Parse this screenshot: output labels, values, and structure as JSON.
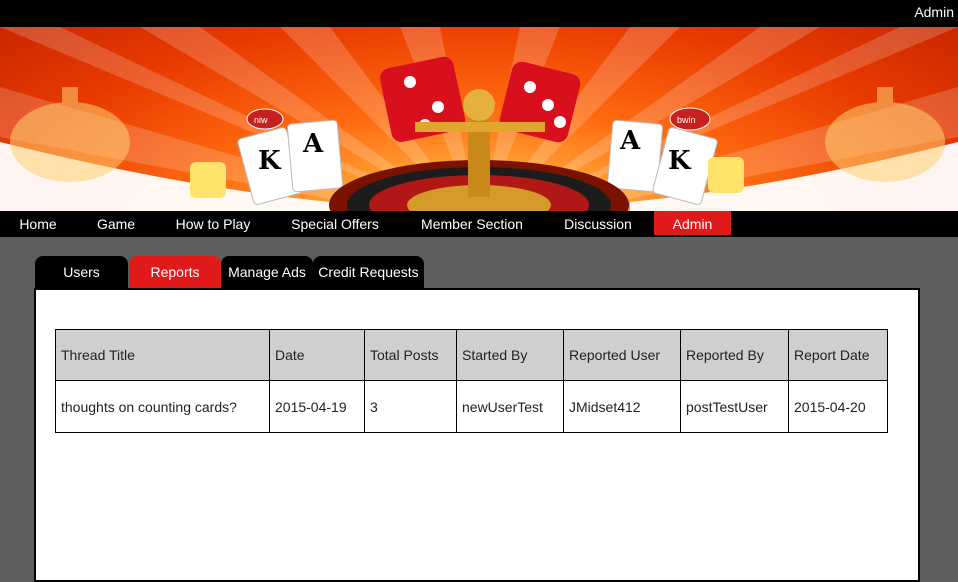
{
  "topbar": {
    "user_label": "Admin"
  },
  "nav": {
    "items": [
      {
        "label": "Home"
      },
      {
        "label": "Game"
      },
      {
        "label": "How to Play"
      },
      {
        "label": "Special Offers"
      },
      {
        "label": "Member Section"
      },
      {
        "label": "Discussion"
      },
      {
        "label": "Admin",
        "active": true
      }
    ]
  },
  "tabs": [
    {
      "label": "Users"
    },
    {
      "label": "Reports",
      "active": true
    },
    {
      "label": "Manage Ads"
    },
    {
      "label": "Credit Requests"
    }
  ],
  "banner": {
    "left_card_ranks": [
      "K",
      "A"
    ],
    "right_card_ranks": [
      "A",
      "K"
    ],
    "chip_text": "bwin"
  },
  "reports_table": {
    "headers": [
      "Thread Title",
      "Date",
      "Total Posts",
      "Started By",
      "Reported User",
      "Reported By",
      "Report Date"
    ],
    "rows": [
      [
        "thoughts on counting cards?",
        "2015-04-19",
        "3",
        "newUserTest",
        "JMidset412",
        "postTestUser",
        "2015-04-20"
      ]
    ]
  },
  "colors": {
    "accent": "#e01a1a",
    "nav_bg": "#000000",
    "page_bg": "#5e5e5e",
    "header_cell_bg": "#cfcfcf"
  }
}
